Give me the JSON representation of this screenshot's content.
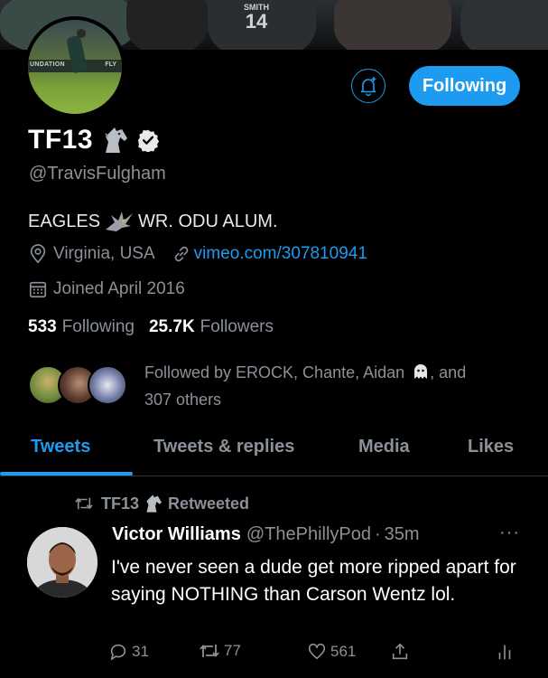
{
  "banner": {
    "jersey_name": "SMITH",
    "jersey_number": "14"
  },
  "avatar": {
    "wall_text_left": "UNDATION",
    "wall_text_right": "FLY"
  },
  "profile": {
    "display_name": "TF13",
    "handle": "@TravisFulgham",
    "bio_part1": "EAGLES",
    "bio_part2": "WR. ODU ALUM.",
    "location": "Virginia, USA",
    "website": "vimeo.com/307810941",
    "joined": "Joined April 2016"
  },
  "actions": {
    "follow_label": "Following"
  },
  "stats": {
    "following_count": "533",
    "following_label": "Following",
    "followers_count": "25.7K",
    "followers_label": "Followers"
  },
  "followed_by": {
    "prefix": "Followed by EROCK, Chante, Aidan",
    "suffix": ", and",
    "line2": "307 others"
  },
  "tabs": [
    {
      "label": "Tweets"
    },
    {
      "label": "Tweets & replies"
    },
    {
      "label": "Media"
    },
    {
      "label": "Likes"
    }
  ],
  "tweet": {
    "retweeted_by": "TF13",
    "retweeted_label": "Retweeted",
    "author_name": "Victor Williams",
    "author_handle": "@ThePhillyPod",
    "separator": "·",
    "time": "35m",
    "more": "···",
    "text": "I've never seen a dude get more ripped apart for saying NOTHING than Carson Wentz lol.",
    "replies": "31",
    "retweets": "77",
    "likes": "561"
  },
  "colors": {
    "accent": "#1d9bf0",
    "background": "#000000",
    "muted": "#8b9198"
  }
}
